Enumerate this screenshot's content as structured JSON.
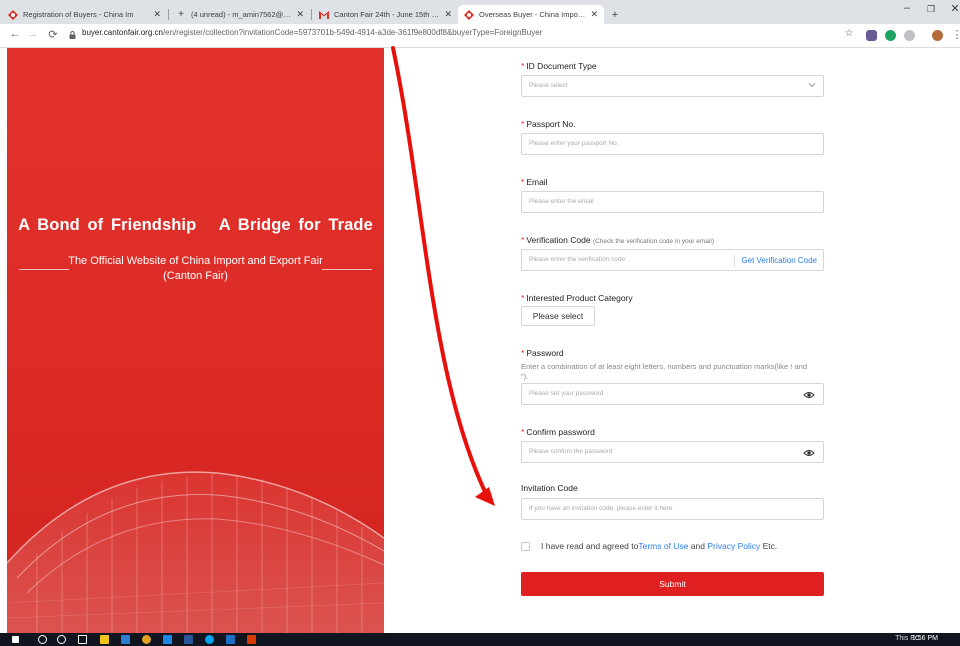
{
  "browser": {
    "tabs": [
      {
        "label": "Registration of Buyers - China Im",
        "active": false
      },
      {
        "label": "(4 unread) - m_amin7562@yaho",
        "active": false
      },
      {
        "label": "Canton Fair 24th - June 15th - m",
        "active": false
      },
      {
        "label": "Overseas Buyer - China Import an",
        "active": true
      }
    ],
    "url_host": "buyer.cantonfair.org.cn",
    "url_path": "/en/register/collection?invitationCode=5973701b-549d-4914-a3de-361f9e800df8&buyerType=ForeignBuyer"
  },
  "hero": {
    "title": "A Bond of Friendship   A Bridge for Trade",
    "subtitle": "The Official Website of China Import and Export Fair (Canton Fair)"
  },
  "form": {
    "id_doc_label": "ID Document Type",
    "id_doc_placeholder": "Please select",
    "passport_label": "Passport No.",
    "passport_placeholder": "Please enter your passport No.",
    "email_label": "Email",
    "email_placeholder": "Please enter the email",
    "verify_label": "Verification Code",
    "verify_hint": "(Check the verification code in your email)",
    "verify_placeholder": "Please enter the verification code",
    "get_code": "Get Verification Code",
    "category_label": "Interested Product Category",
    "category_button": "Please select",
    "password_label": "Password",
    "password_hint": "Enter a combination of at least eight letters, numbers and punctuation marks(like ! and \").",
    "password_placeholder": "Please set your password",
    "confirm_label": "Confirm password",
    "confirm_placeholder": "Please confirm the password",
    "invite_label": "Invitation Code",
    "invite_placeholder": "If you have an invitation code, please enter it here",
    "agree_prefix": "I have read and agreed to",
    "terms_link": "Terms of Use",
    "agree_and": " and ",
    "privacy_link": "Privacy Policy",
    "agree_suffix": " Etc.",
    "submit": "Submit"
  },
  "taskbar": {
    "tray_text": "This PC",
    "clock": "1:56 PM"
  },
  "colors": {
    "brand_red": "#e02020",
    "link_blue": "#2b7de9"
  }
}
